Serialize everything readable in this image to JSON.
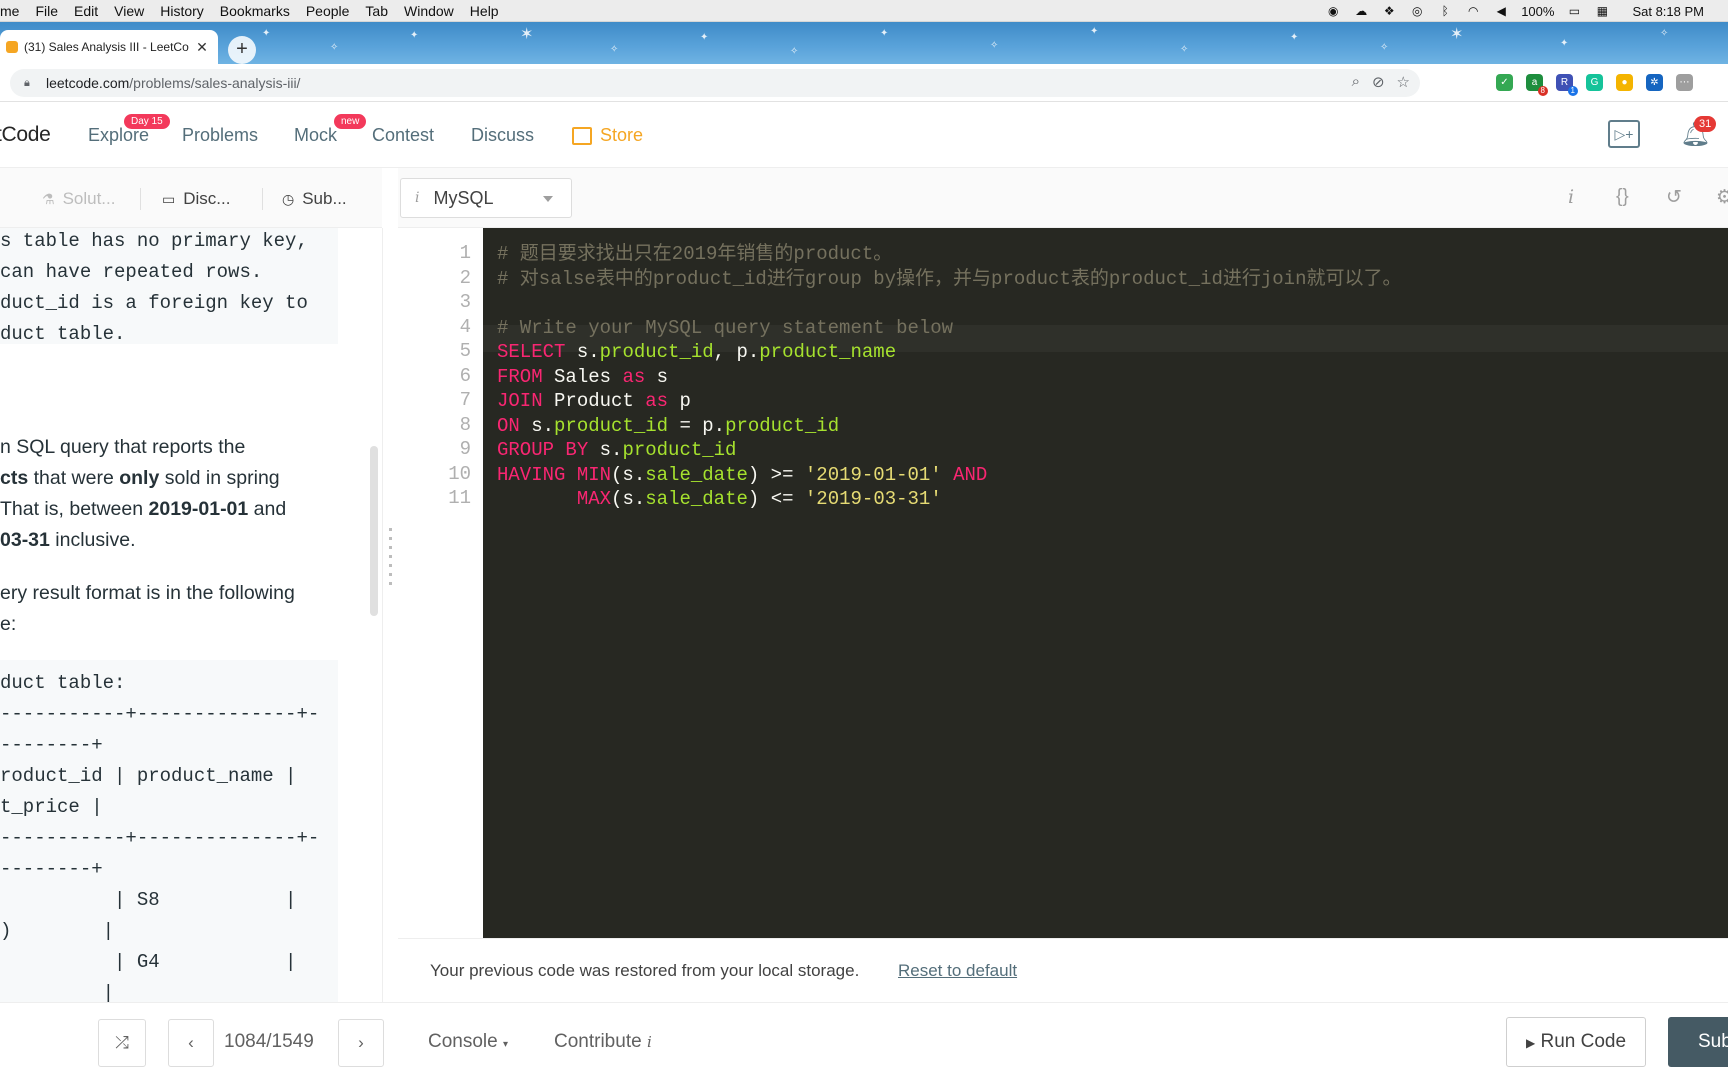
{
  "menubar": {
    "items": [
      "me",
      "File",
      "Edit",
      "View",
      "History",
      "Bookmarks",
      "People",
      "Tab",
      "Window",
      "Help"
    ],
    "battery": "100%",
    "clock": "Sat 8:18 PM"
  },
  "browser": {
    "tab_title": "(31) Sales Analysis III - LeetCo",
    "url_host": "leetcode.com",
    "url_path": "/problems/sales-analysis-iii/",
    "ext_badges": [
      "8",
      "1"
    ]
  },
  "nav": {
    "logo": "tCode",
    "links": [
      "Explore",
      "Problems",
      "Mock",
      "Contest",
      "Discuss"
    ],
    "explore_badge": "Day 15",
    "mock_badge": "new",
    "store": "Store",
    "notifications": "31"
  },
  "left_tabs": {
    "solution": "Solut...",
    "discuss": "Disc...",
    "submissions": "Sub..."
  },
  "description": {
    "code_top": [
      "s table has no primary key,",
      "can have repeated rows.",
      "duct_id is a foreign key to",
      "duct table."
    ],
    "para1": [
      {
        "pre": "n SQL query that reports the",
        "b1": "",
        "mid": "",
        "b2": "",
        "post": ""
      },
      {
        "pre": "",
        "b1": "cts",
        "mid": " that were ",
        "b2": "only",
        "post": " sold in spring"
      },
      {
        "pre": "That is, between ",
        "b1": "2019-01-01",
        "mid": " and",
        "b2": "",
        "post": ""
      },
      {
        "pre": "",
        "b1": "03-31",
        "mid": " inclusive.",
        "b2": "",
        "post": ""
      }
    ],
    "para2": [
      "ery result format is in the following",
      "e:"
    ],
    "code_table": [
      "duct table:",
      "-----------+--------------+-",
      "--------+",
      "roduct_id | product_name |",
      "t_price |",
      "-----------+--------------+-",
      "--------+",
      "          | S8           |",
      ")        |",
      "          | G4           |",
      "         |"
    ]
  },
  "editor": {
    "language": "MySQL",
    "line_numbers": [
      "1",
      "2",
      "3",
      "4",
      "5",
      "6",
      "7",
      "8",
      "9",
      "10",
      "11"
    ],
    "lines": [
      [
        {
          "c": "cm",
          "t": "# 题目要求找出只在2019年销售的product。"
        }
      ],
      [
        {
          "c": "cm",
          "t": "# 对salse表中的product_id进行group by操作，并与product表的product_id进行join就可以了。"
        }
      ],
      [],
      [
        {
          "c": "cm",
          "t": "# Write your MySQL query statement below"
        }
      ],
      [
        {
          "c": "kw",
          "t": "SELECT"
        },
        {
          "c": "",
          "t": " s."
        },
        {
          "c": "fn",
          "t": "product_id"
        },
        {
          "c": "",
          "t": ", p."
        },
        {
          "c": "fn",
          "t": "product_name"
        }
      ],
      [
        {
          "c": "kw",
          "t": "FROM"
        },
        {
          "c": "",
          "t": " Sales "
        },
        {
          "c": "kw",
          "t": "as"
        },
        {
          "c": "",
          "t": " s"
        }
      ],
      [
        {
          "c": "kw",
          "t": "JOIN"
        },
        {
          "c": "",
          "t": " Product "
        },
        {
          "c": "kw",
          "t": "as"
        },
        {
          "c": "",
          "t": " p"
        }
      ],
      [
        {
          "c": "kw",
          "t": "ON"
        },
        {
          "c": "",
          "t": " s."
        },
        {
          "c": "fn",
          "t": "product_id"
        },
        {
          "c": "",
          "t": " = p."
        },
        {
          "c": "fn",
          "t": "product_id"
        }
      ],
      [
        {
          "c": "kw",
          "t": "GROUP BY"
        },
        {
          "c": "",
          "t": " s."
        },
        {
          "c": "fn",
          "t": "product_id"
        }
      ],
      [
        {
          "c": "kw",
          "t": "HAVING MIN"
        },
        {
          "c": "",
          "t": "(s."
        },
        {
          "c": "fn",
          "t": "sale_date"
        },
        {
          "c": "",
          "t": ") >= "
        },
        {
          "c": "str",
          "t": "'2019-01-01'"
        },
        {
          "c": "",
          "t": " "
        },
        {
          "c": "kw",
          "t": "AND"
        }
      ],
      [
        {
          "c": "",
          "t": "       "
        },
        {
          "c": "kw",
          "t": "MAX"
        },
        {
          "c": "",
          "t": "(s."
        },
        {
          "c": "fn",
          "t": "sale_date"
        },
        {
          "c": "",
          "t": ") <= "
        },
        {
          "c": "str",
          "t": "'2019-03-31'"
        }
      ]
    ],
    "restored_msg": "Your previous code was restored from your local storage.",
    "reset_link": "Reset to default"
  },
  "bottom": {
    "pager": "1084/1549",
    "console": "Console",
    "contribute": "Contribute",
    "run": "Run Code",
    "submit": "Sub"
  },
  "colors": {
    "editor_bg": "#272822",
    "keyword": "#f92672",
    "identifier": "#a6e22e",
    "string": "#e6db74",
    "comment": "#75715e",
    "store": "#f5a623",
    "badge": "#f3395b",
    "submit_bg": "#455a64"
  }
}
